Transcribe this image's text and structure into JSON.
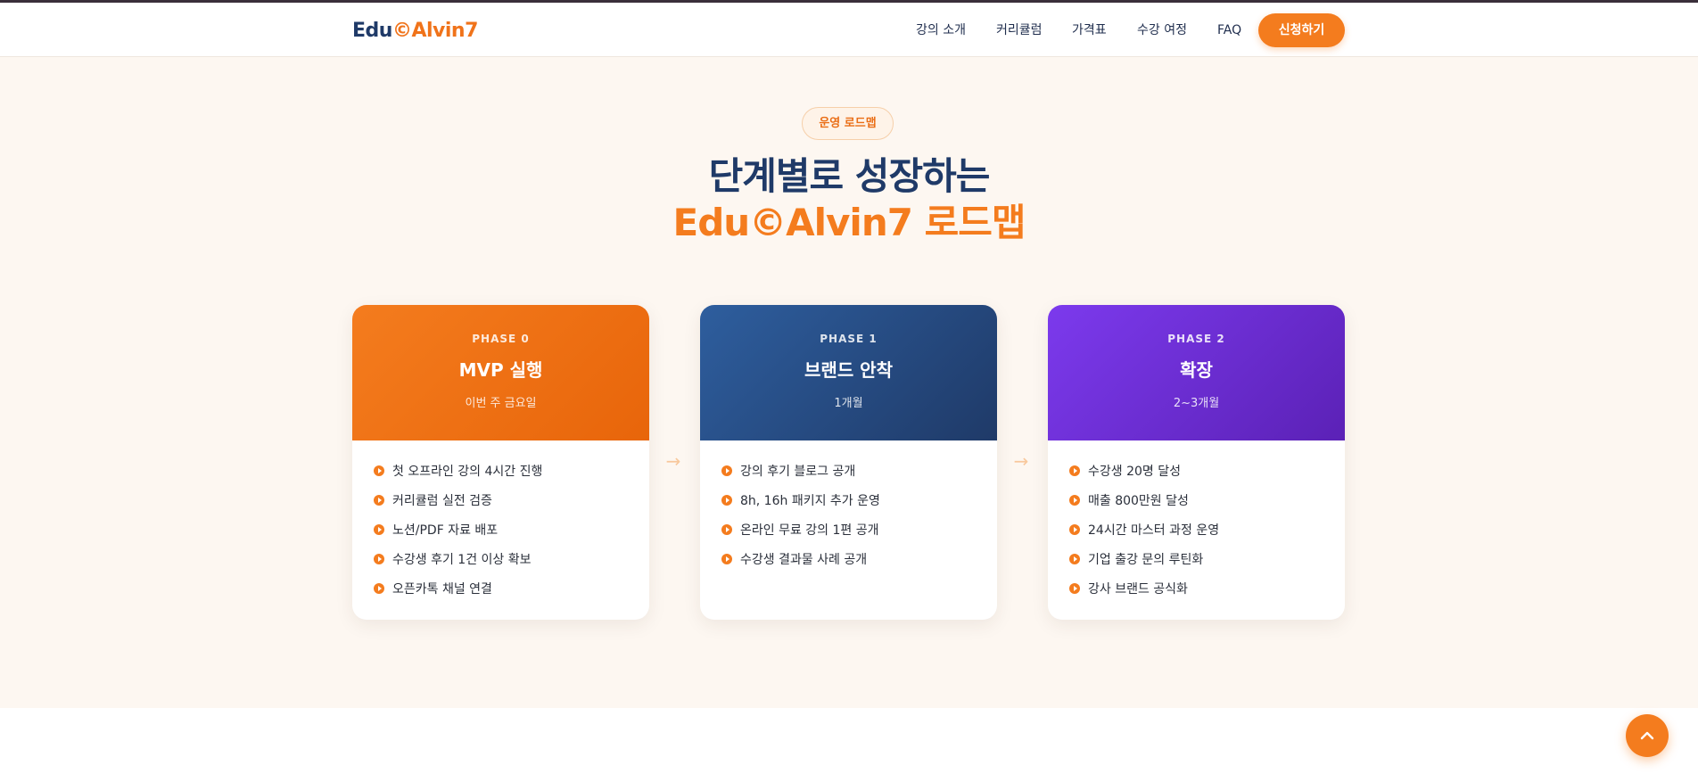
{
  "header": {
    "logo_part1": "Edu",
    "logo_part2": "©Alvin7",
    "nav": [
      "강의 소개",
      "커리큘럼",
      "가격표",
      "수강 여정",
      "FAQ"
    ],
    "cta_label": "신청하기"
  },
  "section": {
    "badge": "운영 로드맵",
    "title_line1": "단계별로 성장하는",
    "title_line2": "Edu©Alvin7 로드맵"
  },
  "phases": [
    {
      "label": "PHASE 0",
      "name": "MVP 실행",
      "time": "이번 주 금요일",
      "color_start": "#f47c1e",
      "color_end": "#e8650a",
      "items": [
        "첫 오프라인 강의 4시간 진행",
        "커리큘럼 실전 검증",
        "노션/PDF 자료 배포",
        "수강생 후기 1건 이상 확보",
        "오픈카톡 채널 연결"
      ]
    },
    {
      "label": "PHASE 1",
      "name": "브랜드 안착",
      "time": "1개월",
      "color_start": "#2e5e9e",
      "color_end": "#1f3a68",
      "items": [
        "강의 후기 블로그 공개",
        "8h, 16h 패키지 추가 운영",
        "온라인 무료 강의 1편 공개",
        "수강생 결과물 사례 공개"
      ]
    },
    {
      "label": "PHASE 2",
      "name": "확장",
      "time": "2~3개월",
      "color_start": "#7c3aed",
      "color_end": "#5b21b6",
      "items": [
        "수강생 20명 달성",
        "매출 800만원 달성",
        "24시간 마스터 과정 운영",
        "기업 출강 문의 루틴화",
        "강사 브랜드 공식화"
      ]
    }
  ],
  "icons": {
    "arrow": "arrow-right-icon",
    "bullet": "play-circle-icon",
    "scroll_top": "chevron-up-icon"
  }
}
